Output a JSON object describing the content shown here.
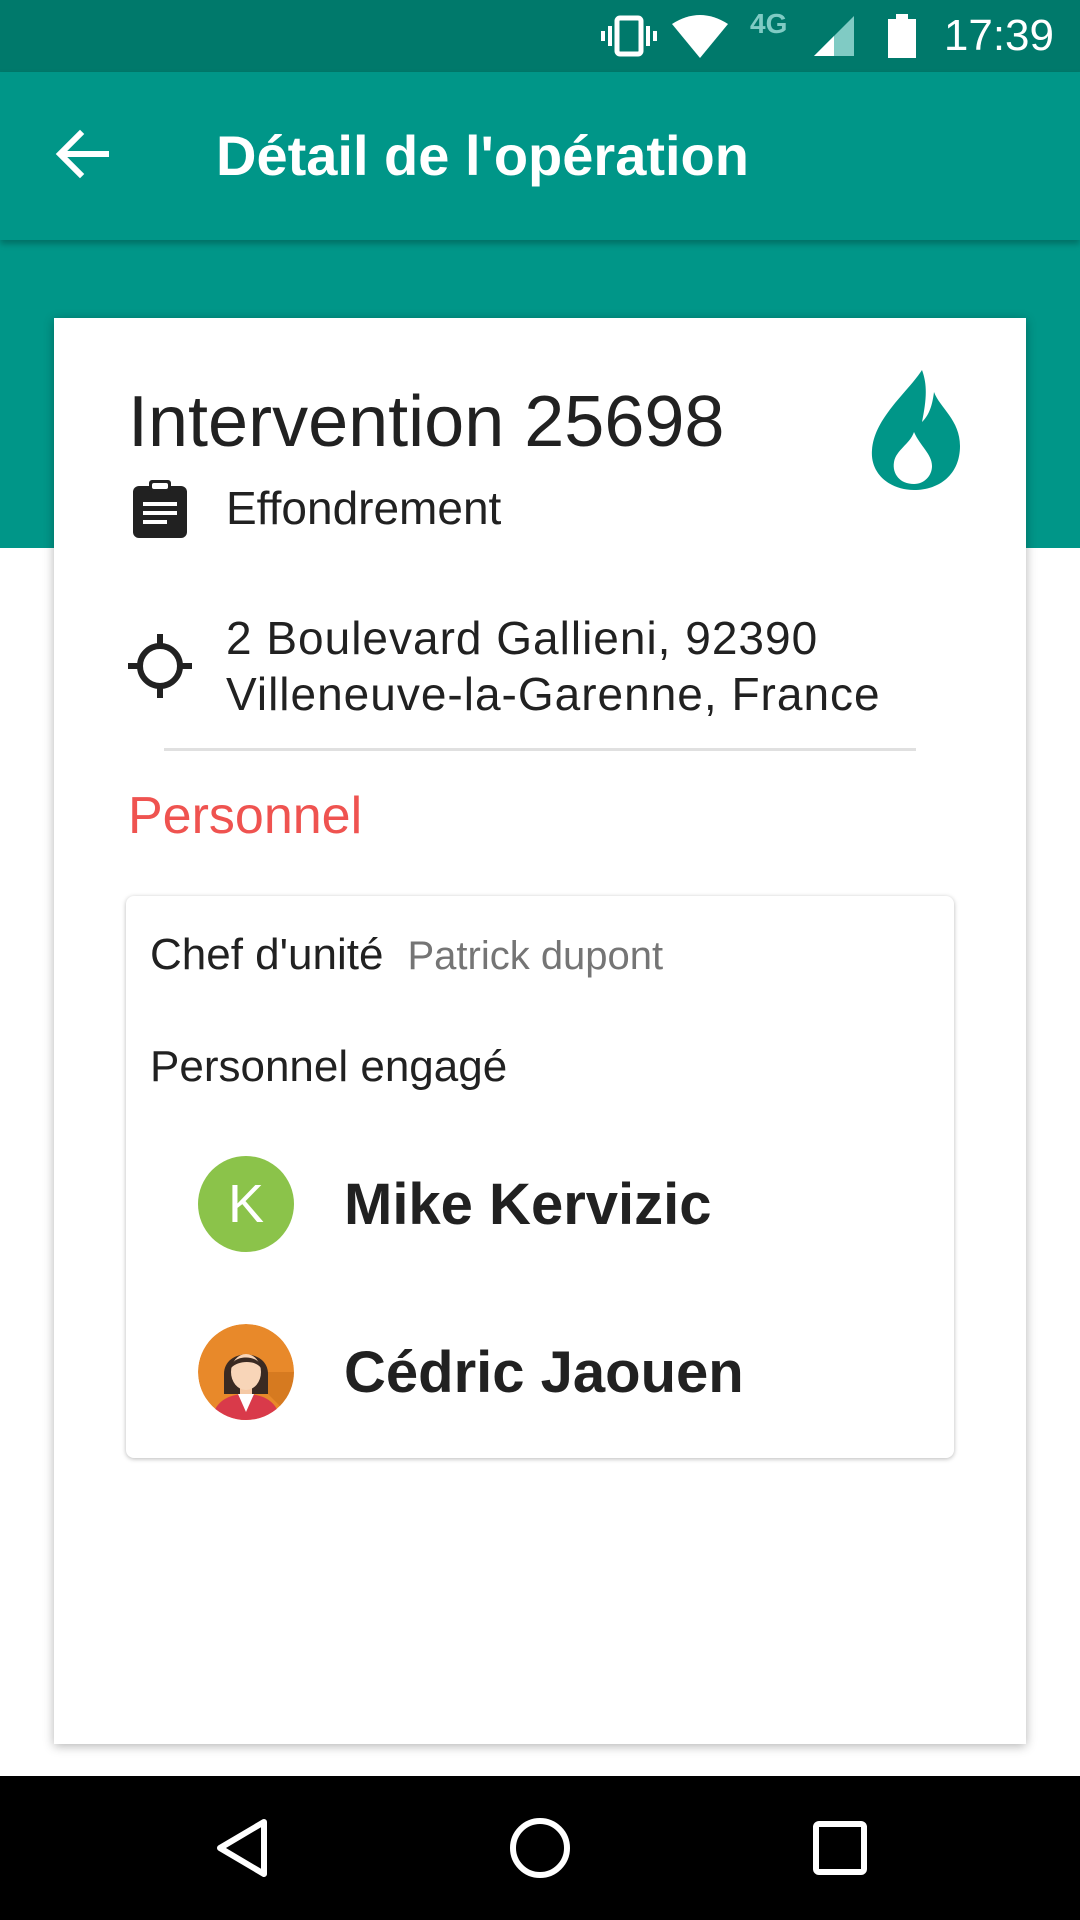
{
  "status_bar": {
    "time": "17:39",
    "network": "4G",
    "icons": [
      "vibrate-icon",
      "wifi-icon",
      "cell-signal-icon",
      "battery-icon"
    ]
  },
  "app_bar": {
    "title": "Détail de l'opération",
    "back_icon": "arrow-back-icon"
  },
  "operation": {
    "title": "Intervention 25698",
    "type_icon": "clipboard-icon",
    "type": "Effondrement",
    "location_icon": "crosshair-icon",
    "address_line1": "2 Boulevard Gallieni, 92390",
    "address_line2": "Villeneuve-la-Garenne, France",
    "category_icon": "flame-icon"
  },
  "personnel": {
    "section_title": "Personnel",
    "chef_label": "Chef d'unité",
    "chef_value": "Patrick dupont",
    "engaged_label": "Personnel engagé",
    "members": [
      {
        "initial": "K",
        "name": "Mike Kervizic"
      },
      {
        "initial": "",
        "name": "Cédric Jaouen"
      }
    ]
  },
  "colors": {
    "status_bar": "#00796b",
    "primary": "#009688",
    "accent_section": "#ef5350",
    "avatar_letter_bg": "#8bc34a",
    "nav_bar": "#000000"
  },
  "nav_bar": {
    "buttons": [
      "back-triangle-icon",
      "home-circle-icon",
      "recents-square-icon"
    ]
  }
}
